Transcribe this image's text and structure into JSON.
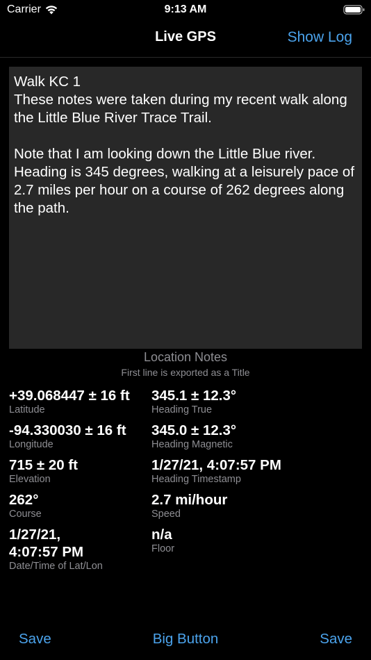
{
  "status_bar": {
    "carrier": "Carrier",
    "time": "9:13 AM",
    "icons": [
      "wifi-icon",
      "battery-icon"
    ]
  },
  "nav": {
    "title": "Live GPS",
    "right_button": "Show Log"
  },
  "notes": {
    "text": "Walk KC 1\nThese notes were taken during my recent walk along the Little Blue River Trace Trail.\n\nNote that I am looking down the Little Blue river. Heading is 345 degrees, walking at a leisurely pace of 2.7 miles per hour on a course of 262 degrees along the path.",
    "caption": "Location Notes",
    "subcaption": "First line is exported as a Title"
  },
  "fields": {
    "latitude": {
      "value": "+39.068447 ± 16 ft",
      "label": "Latitude"
    },
    "heading_true": {
      "value": "345.1 ± 12.3°",
      "label": "Heading True"
    },
    "longitude": {
      "value": "-94.330030 ± 16 ft",
      "label": "Longitude"
    },
    "heading_magnetic": {
      "value": "345.0 ± 12.3°",
      "label": "Heading Magnetic"
    },
    "elevation": {
      "value": "715 ± 20 ft",
      "label": "Elevation"
    },
    "heading_timestamp": {
      "value": "1/27/21, 4:07:57 PM",
      "label": "Heading Timestamp"
    },
    "course": {
      "value": "262°",
      "label": "Course"
    },
    "speed": {
      "value": "2.7 mi/hour",
      "label": "Speed"
    },
    "datetime": {
      "value": "1/27/21,\n4:07:57 PM",
      "label": "Date/Time of Lat/Lon"
    },
    "floor": {
      "value": "n/a",
      "label": "Floor"
    }
  },
  "toolbar": {
    "left": "Save",
    "center": "Big Button",
    "right": "Save"
  },
  "colors": {
    "background": "#000000",
    "accent": "#4ba3ec",
    "notes_background": "#282828",
    "secondary_text": "#8e8e93"
  }
}
